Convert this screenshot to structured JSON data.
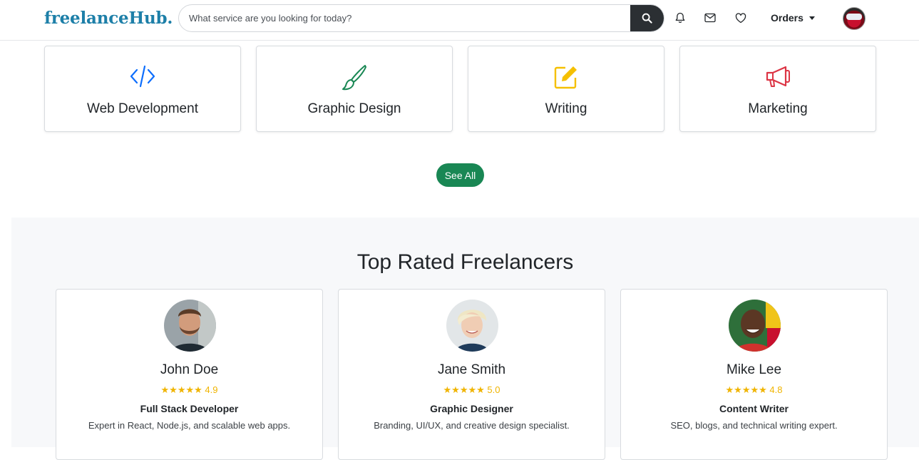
{
  "navbar": {
    "brand": "freelanceHub.",
    "search_placeholder": "What service are you looking for today?",
    "orders_label": "Orders",
    "icons": [
      "search-icon",
      "bell-icon",
      "envelope-icon",
      "heart-icon",
      "caret-down-icon"
    ]
  },
  "categories": [
    {
      "label": "Web Development",
      "icon": "code-icon",
      "color": "#0d6efd"
    },
    {
      "label": "Graphic Design",
      "icon": "brush-icon",
      "color": "#198754"
    },
    {
      "label": "Writing",
      "icon": "pencil-square-icon",
      "color": "#f5c000"
    },
    {
      "label": "Marketing",
      "icon": "megaphone-icon",
      "color": "#dc3545"
    }
  ],
  "see_all_label": "See All",
  "top_rated": {
    "title": "Top Rated Freelancers",
    "freelancers": [
      {
        "name": "John Doe",
        "rating": "★★★★★ 4.9",
        "role": "Full Stack Developer",
        "description": "Expert in React, Node.js, and scalable web apps."
      },
      {
        "name": "Jane Smith",
        "rating": "★★★★★ 5.0",
        "role": "Graphic Designer",
        "description": "Branding, UI/UX, and creative design specialist."
      },
      {
        "name": "Mike Lee",
        "rating": "★★★★★ 4.8",
        "role": "Content Writer",
        "description": "SEO, blogs, and technical writing expert."
      }
    ]
  },
  "colors": {
    "brand": "#1d7fa8",
    "accent": "#198754",
    "star": "#f0b400",
    "section_bg": "#f7f8fa"
  }
}
